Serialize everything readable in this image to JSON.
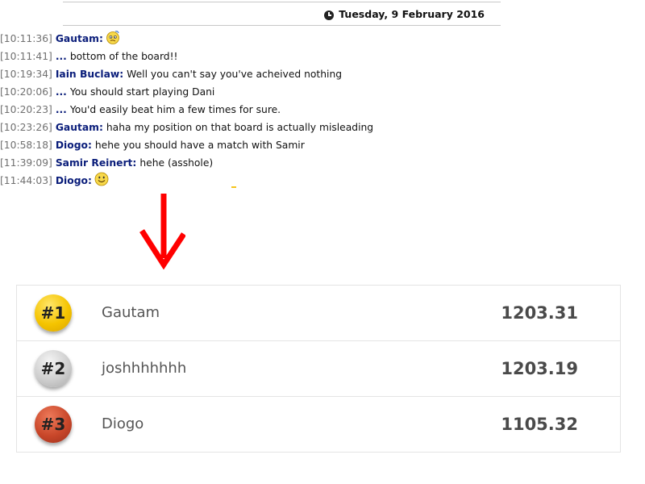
{
  "chat": {
    "date": "Tuesday, 9 February 2016",
    "messages": [
      {
        "time": "[10:11:36]",
        "author": "Gautam:",
        "text": "",
        "emoji": "confused-smiley-icon"
      },
      {
        "time": "[10:11:41]",
        "author": "...",
        "text": "bottom of the board!!"
      },
      {
        "time": "[10:19:34]",
        "author": "Iain Buclaw:",
        "text": "Well you can't say you've acheived nothing"
      },
      {
        "time": "[10:20:06]",
        "author": "...",
        "text": "You should start playing Dani"
      },
      {
        "time": "[10:20:23]",
        "author": "...",
        "text": "You'd easily beat him a few times for sure."
      },
      {
        "time": "[10:23:26]",
        "author": "Gautam:",
        "text": "haha my position on that board is actually misleading"
      },
      {
        "time": "[10:58:18]",
        "author": "Diogo:",
        "text": "hehe you should have a match with Samir"
      },
      {
        "time": "[11:39:09]",
        "author": "Samir Reinert:",
        "text": "hehe (asshole)"
      },
      {
        "time": "[11:44:03]",
        "author": "Diogo:",
        "text": "",
        "emoji": "smiley-icon"
      }
    ]
  },
  "arrow": {
    "icon": "down-arrow-icon",
    "color": "#ff0000"
  },
  "leaderboard": {
    "rows": [
      {
        "rank": "#1",
        "name": "Gautam",
        "score": "1203.31",
        "badge": "gold",
        "color": "#f5c400"
      },
      {
        "rank": "#2",
        "name": "joshhhhhhh",
        "score": "1203.19",
        "badge": "silver",
        "color": "#c8c8c8"
      },
      {
        "rank": "#3",
        "name": "Diogo",
        "score": "1105.32",
        "badge": "bronze",
        "color": "#c0392b"
      }
    ]
  }
}
